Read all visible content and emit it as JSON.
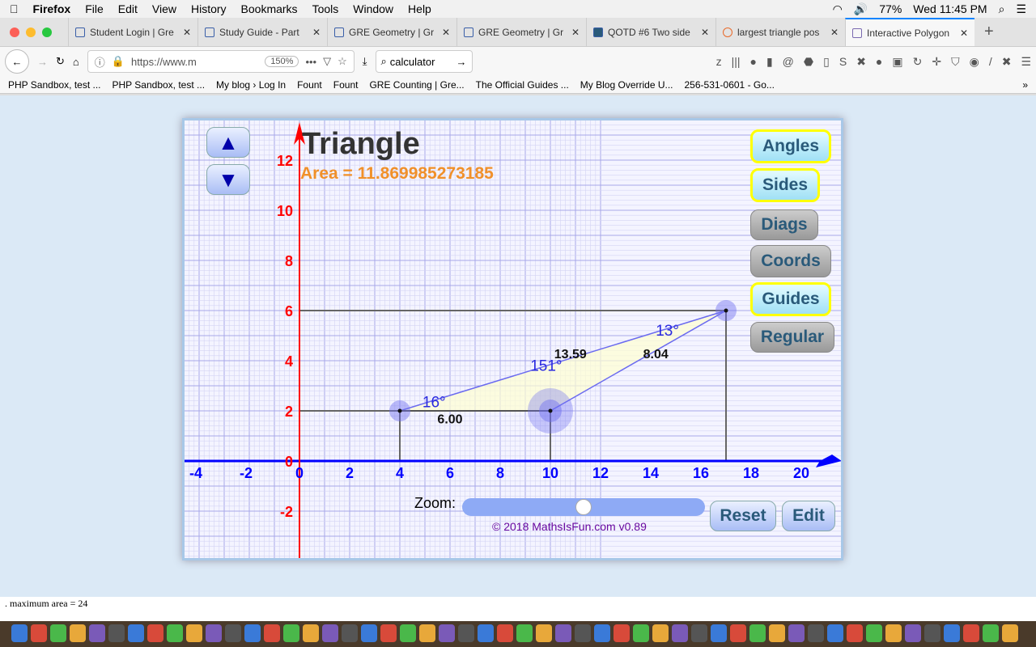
{
  "menubar": {
    "app": "Firefox",
    "items": [
      "File",
      "Edit",
      "View",
      "History",
      "Bookmarks",
      "Tools",
      "Window",
      "Help"
    ],
    "battery": "77%",
    "clock": "Wed 11:45 PM"
  },
  "tabs": [
    {
      "label": "Student Login | Gre"
    },
    {
      "label": "Study Guide - Part"
    },
    {
      "label": "GRE Geometry | Gr"
    },
    {
      "label": "GRE Geometry | Gr"
    },
    {
      "label": "QOTD #6 Two side"
    },
    {
      "label": "largest triangle pos"
    },
    {
      "label": "Interactive Polygon",
      "active": true
    }
  ],
  "nav": {
    "url": "https://www.m",
    "zoom": "150%",
    "search": "calculator"
  },
  "bookmarks": [
    "PHP Sandbox, test ...",
    "PHP Sandbox, test ...",
    "My blog › Log In",
    "Fount",
    "Fount",
    "GRE Counting | Gre...",
    "The Official Guides ...",
    "My Blog Override U...",
    "256-531-0601 - Go..."
  ],
  "app": {
    "title": "Triangle",
    "area": "Area = 11.869985273185",
    "buttons": {
      "angles": "Angles",
      "sides": "Sides",
      "diags": "Diags",
      "coords": "Coords",
      "guides": "Guides",
      "regular": "Regular",
      "reset": "Reset",
      "edit": "Edit",
      "up": "▲",
      "down": "▼"
    },
    "zoom_label": "Zoom:",
    "zoom_level": 0.5,
    "copyright": "© 2018 MathsIsFun.com v0.89",
    "vertices": [
      [
        4,
        2
      ],
      [
        10,
        2
      ],
      [
        17,
        6
      ]
    ],
    "angles": [
      "16°",
      "151°",
      "13°"
    ],
    "sides": [
      "6.00",
      "8.04",
      "13.59"
    ],
    "x_ticks": [
      -4,
      -2,
      0,
      2,
      4,
      6,
      8,
      10,
      12,
      14,
      16,
      18,
      20
    ],
    "y_ticks": [
      -2,
      0,
      2,
      4,
      6,
      8,
      10,
      12
    ],
    "colors": {
      "x_axis": "#0000ff",
      "y_axis": "#ff0000",
      "shape": "#6a6af0",
      "area": "#f0902a"
    }
  },
  "status": ". maximum area = 24"
}
